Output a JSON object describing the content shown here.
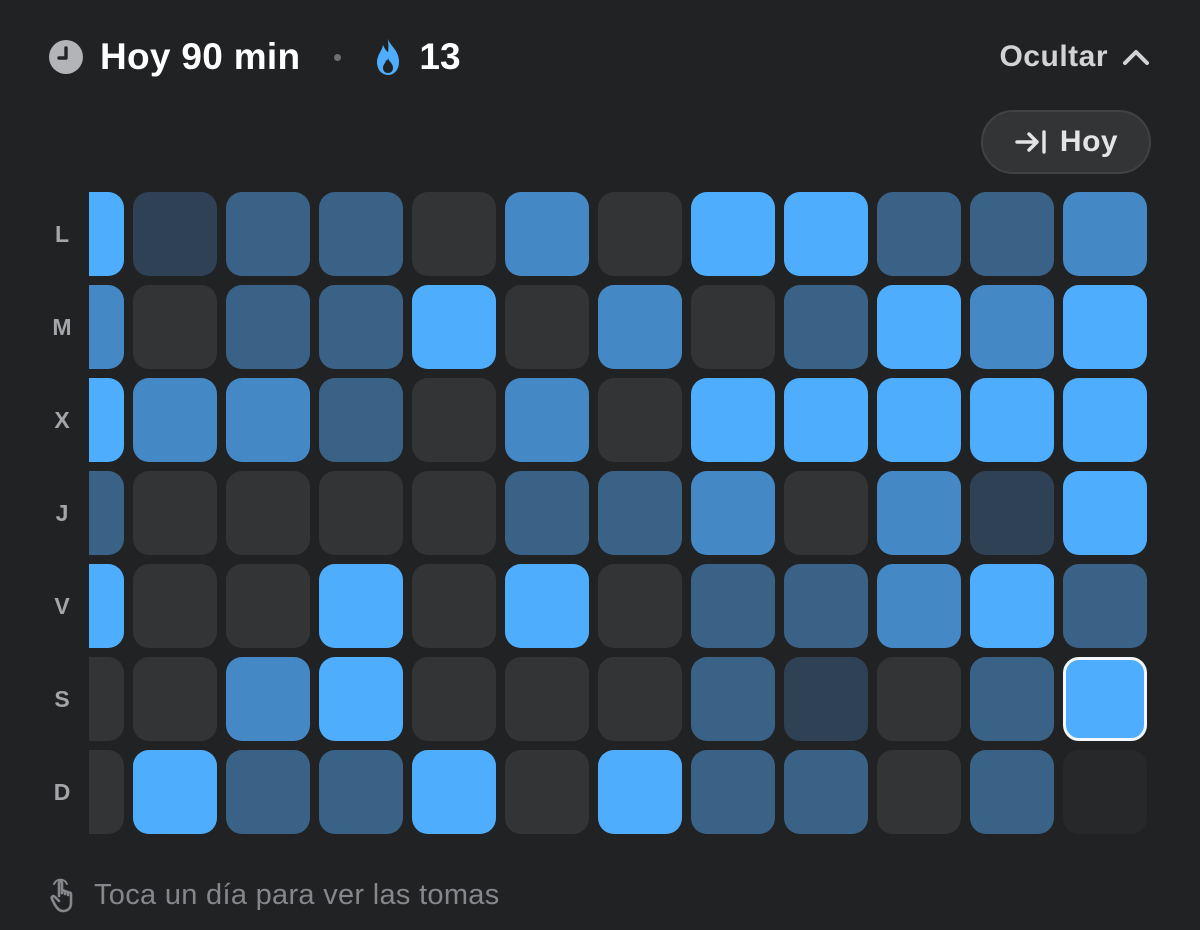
{
  "header": {
    "icon": "clock-icon",
    "today_text": "Hoy 90 min",
    "streak_icon": "flame-icon",
    "streak_count": "13",
    "hide_label": "Ocultar",
    "hide_icon": "chevron-up-icon"
  },
  "today_button": {
    "icon": "jump-to-end-icon",
    "label": "Hoy"
  },
  "heatmap": {
    "day_labels": [
      "L",
      "M",
      "X",
      "J",
      "V",
      "S",
      "D"
    ],
    "levels_palette": {
      "0": "#333436",
      "1": "#2e4155",
      "2": "#3a6286",
      "3": "#4488c6",
      "4": "#4eaefd"
    },
    "rows": [
      [
        4,
        1,
        2,
        2,
        0,
        3,
        0,
        4,
        4,
        2,
        2,
        3
      ],
      [
        3,
        0,
        2,
        2,
        4,
        0,
        3,
        0,
        2,
        4,
        3,
        4
      ],
      [
        4,
        3,
        3,
        2,
        0,
        3,
        0,
        4,
        4,
        4,
        4,
        4
      ],
      [
        2,
        0,
        0,
        0,
        0,
        2,
        2,
        3,
        0,
        3,
        1,
        4
      ],
      [
        4,
        0,
        0,
        4,
        0,
        4,
        0,
        2,
        2,
        3,
        4,
        2
      ],
      [
        0,
        0,
        3,
        4,
        0,
        0,
        0,
        2,
        1,
        0,
        2,
        4
      ],
      [
        0,
        4,
        2,
        2,
        4,
        0,
        4,
        2,
        2,
        0,
        2,
        null
      ]
    ],
    "selected": {
      "row": 5,
      "col": 11
    }
  },
  "footer": {
    "icon": "tap-hand-icon",
    "hint": "Toca un día para ver las tomas"
  }
}
